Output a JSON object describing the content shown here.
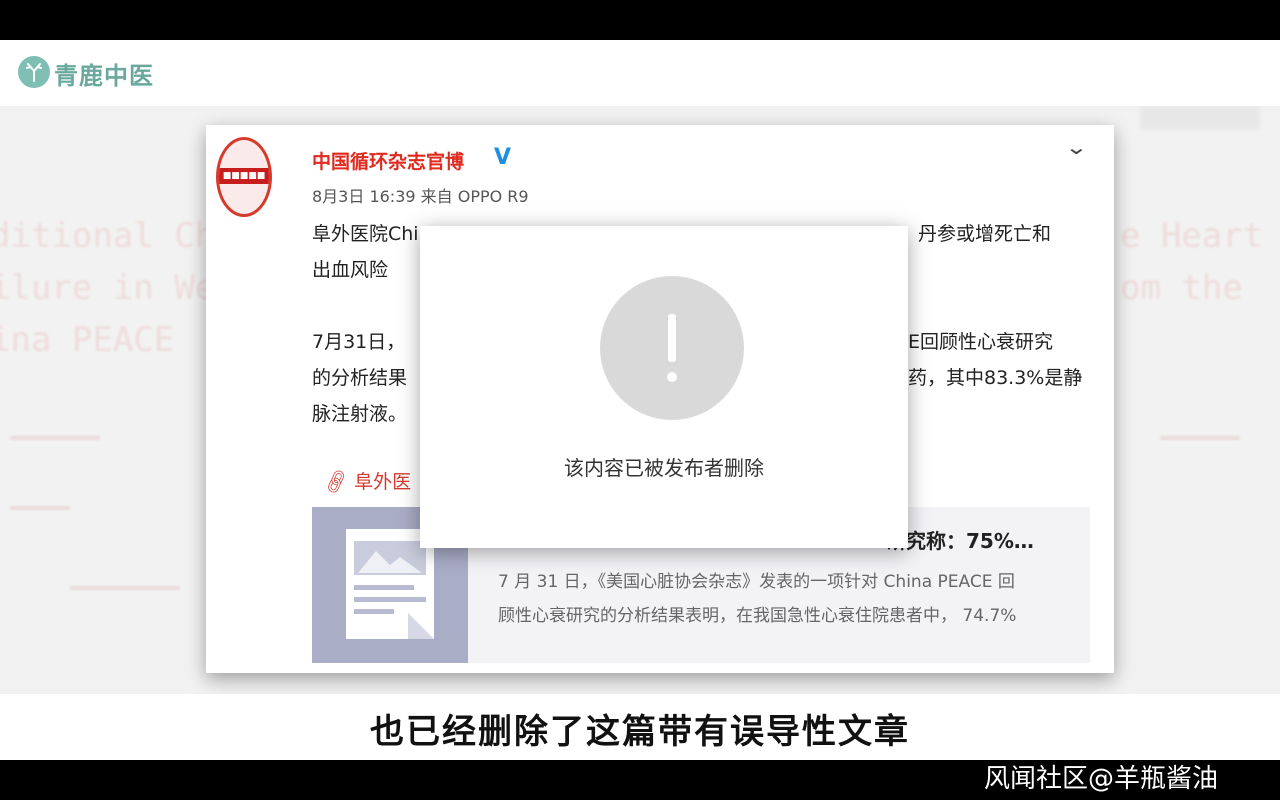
{
  "brand": {
    "name": "青鹿中医"
  },
  "weibo": {
    "author": "中国循环杂志官博",
    "verified_mark": "V",
    "meta": "8月3日 16:39 来自 OPPO R9",
    "lines": [
      "阜外医院Chi",
      "丹参或增死亡和",
      "出血风险",
      "7月31日，",
      "E回顾性心衰研究",
      "的分析结果",
      "药，其中83.3%是静",
      "脉注射液。"
    ],
    "link_text": "阜外医",
    "article": {
      "title": "研究称：75%…",
      "desc_line1": "7 月 31 日，《美国心脏协会杂志》发表的一项针对 China PEACE 回",
      "desc_line2": "顾性心衰研究的分析结果表明，在我国急性心衰住院患者中， 74.7%"
    }
  },
  "dialog": {
    "message": "该内容已被发布者删除"
  },
  "subtitle": "也已经删除了这篇带有误导性文章",
  "watermark": "风闻社区@羊瓶酱油",
  "colors": {
    "brand": "#6aa89e",
    "author": "#e02a1f",
    "verified": "#1f8ee0",
    "link": "#d43a2e"
  }
}
